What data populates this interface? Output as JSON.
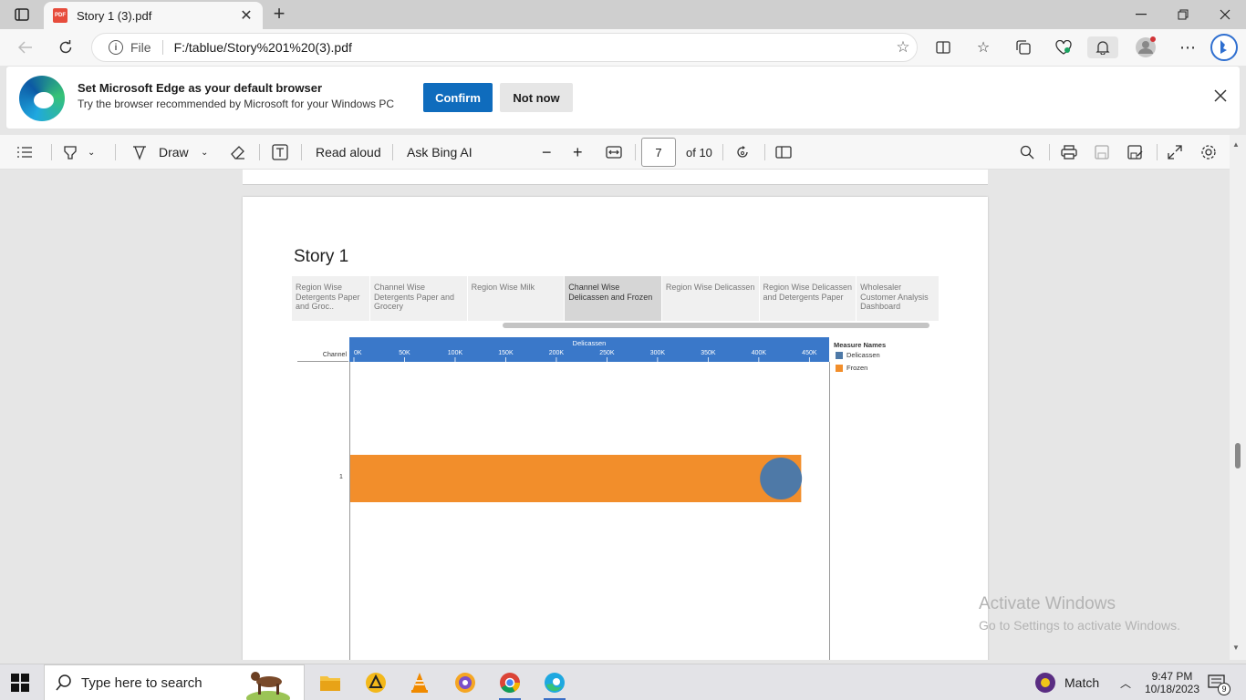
{
  "browser": {
    "tab_title": "Story 1 (3).pdf",
    "tab_close": "✕",
    "new_tab": "+",
    "file_label": "File",
    "url": "F:/tablue/Story%201%20(3).pdf"
  },
  "banner": {
    "title": "Set Microsoft Edge as your default browser",
    "subtitle": "Try the browser recommended by Microsoft for your Windows PC",
    "confirm_label": "Confirm",
    "not_now_label": "Not now"
  },
  "pdf_toolbar": {
    "draw_label": "Draw",
    "read_aloud_label": "Read aloud",
    "ask_bing_label": "Ask Bing AI",
    "current_page": "7",
    "total_pages": "of 10"
  },
  "story": {
    "title": "Story 1",
    "tabs": [
      {
        "label": "Region Wise Detergents Paper and Groc..",
        "active": false
      },
      {
        "label": "Channel Wise Detergents Paper and Grocery",
        "active": false
      },
      {
        "label": "Region Wise Milk",
        "active": false
      },
      {
        "label": "Channel Wise Delicassen and Frozen",
        "active": true
      },
      {
        "label": "Region Wise Delicassen",
        "active": false
      },
      {
        "label": "Region Wise Delicassen and Detergents Paper",
        "active": false
      },
      {
        "label": "Wholesaler Customer Analysis Dashboard",
        "active": false
      }
    ]
  },
  "chart_data": {
    "type": "bar",
    "title": "",
    "xlabel": "Delicassen",
    "row_header": "Channel",
    "categories": [
      "1"
    ],
    "xlim": [
      0,
      465000
    ],
    "ticks": [
      "0K",
      "50K",
      "100K",
      "150K",
      "200K",
      "250K",
      "300K",
      "350K",
      "400K",
      "450K"
    ],
    "tick_values": [
      0,
      50000,
      100000,
      150000,
      200000,
      250000,
      300000,
      350000,
      400000,
      450000
    ],
    "series": [
      {
        "name": "Frozen",
        "mark": "bar",
        "color": "#f28e2b",
        "values": [
          441000
        ]
      },
      {
        "name": "Delicassen",
        "mark": "circle",
        "color": "#4e79a7",
        "values": [
          421000
        ]
      }
    ],
    "legend_title": "Measure Names",
    "legend": [
      {
        "label": "Delicassen",
        "color": "#4e79a7"
      },
      {
        "label": "Frozen",
        "color": "#f28e2b"
      }
    ]
  },
  "watermark": {
    "line1": "Activate Windows",
    "line2": "Go to Settings to activate Windows."
  },
  "taskbar": {
    "search_placeholder": "Type here to search",
    "match_label": "Match",
    "time": "9:47 PM",
    "date": "10/18/2023",
    "notification_count": "9"
  }
}
